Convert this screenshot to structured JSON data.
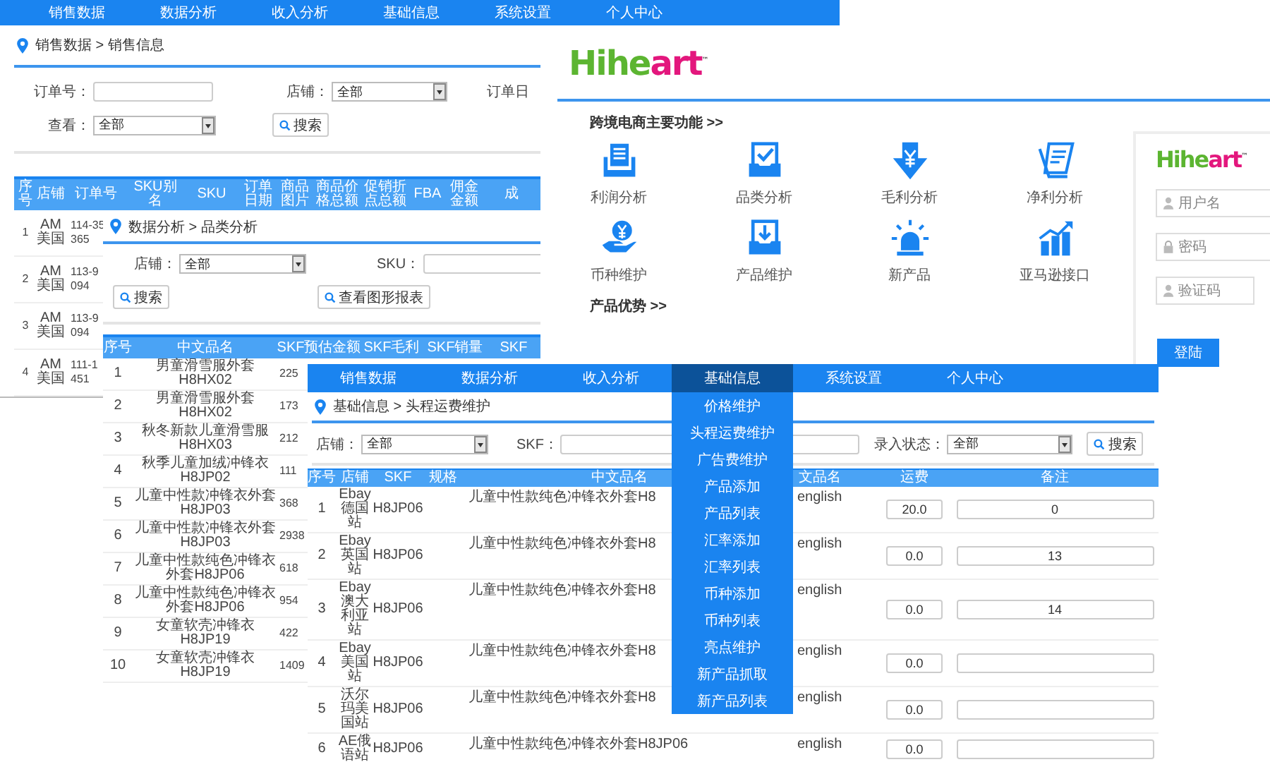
{
  "sales_window": {
    "nav": [
      {
        "label": "销售数据",
        "selected": false
      },
      {
        "label": "数据分析",
        "selected": false
      },
      {
        "label": "收入分析",
        "selected": false
      },
      {
        "label": "基础信息",
        "selected": false
      },
      {
        "label": "系统设置",
        "selected": false
      },
      {
        "label": "个人中心",
        "selected": false
      }
    ],
    "breadcrumb": "销售数据 > 销售信息",
    "filters": [
      [
        {
          "kind": "input",
          "label": "订单号："
        },
        {
          "kind": "select",
          "label": "店铺：",
          "value": "全部"
        },
        {
          "kind": "label",
          "label": "订单日"
        }
      ],
      [
        {
          "kind": "select",
          "label": "查看：",
          "value": "全部"
        },
        {
          "kind": "button",
          "label": "搜索"
        }
      ]
    ],
    "table": {
      "columns": [
        "序号",
        "店铺",
        "订单号",
        "SKU别名",
        "SKU",
        "订单日期",
        "商品图片",
        "商品价格总额",
        "促销折点总额",
        "FBA",
        "佣金金额",
        "成"
      ],
      "rows": [
        {
          "no": "1",
          "store": "AM美国",
          "order": "114-35 365"
        },
        {
          "no": "2",
          "store": "AM美国",
          "order": "113-9 094"
        },
        {
          "no": "3",
          "store": "AM美国",
          "order": "113-9 094"
        },
        {
          "no": "4",
          "store": "AM美国",
          "order": "111-1 451"
        }
      ]
    }
  },
  "home_window": {
    "logo": {
      "parts": [
        {
          "text": "Hihe",
          "color": "#5cb531"
        },
        {
          "text": "art",
          "color": "#e3177d"
        }
      ],
      "mark": "™"
    },
    "features_title": "跨境电商主要功能 >>",
    "features": [
      "利润分析",
      "品类分析",
      "毛利分析",
      "净利分析",
      "币种维护",
      "产品维护",
      "新产品",
      "亚马逊接口"
    ],
    "advantages_title": "产品优势 >>",
    "login": {
      "logo": {
        "parts": [
          {
            "text": "Hihe",
            "color": "#5cb531"
          },
          {
            "text": "art",
            "color": "#e3177d"
          }
        ],
        "mark": "™"
      },
      "fields": [
        {
          "kind": "user",
          "placeholder": "用户名"
        },
        {
          "kind": "password",
          "placeholder": "密码"
        },
        {
          "kind": "captcha",
          "placeholder": "验证码"
        }
      ],
      "button": "登陆"
    }
  },
  "category_window": {
    "breadcrumb": "数据分析 > 品类分析",
    "filters": [
      {
        "kind": "select",
        "label": "店铺：",
        "value": "全部"
      },
      {
        "kind": "input",
        "label": "SKU："
      }
    ],
    "buttons": [
      "搜索",
      "查看图形报表"
    ],
    "table": {
      "columns": [
        "序号",
        "中文品名",
        "SKF预估金额",
        "SKF毛利",
        "SKF销量",
        "SKF"
      ],
      "rows": [
        {
          "no": "1",
          "name": "男童滑雪服外套H8HX02",
          "amount": "225"
        },
        {
          "no": "2",
          "name": "男童滑雪服外套H8HX02",
          "amount": "173"
        },
        {
          "no": "3",
          "name": "秋冬新款儿童滑雪服H8HX03",
          "amount": "212"
        },
        {
          "no": "4",
          "name": "秋季儿童加绒冲锋衣H8JP02",
          "amount": "111"
        },
        {
          "no": "5",
          "name": "儿童中性款冲锋衣外套H8JP03",
          "amount": "368"
        },
        {
          "no": "6",
          "name": "儿童中性款冲锋衣外套H8JP03",
          "amount": "2938"
        },
        {
          "no": "7",
          "name": "儿童中性款纯色冲锋衣外套H8JP06",
          "amount": "618"
        },
        {
          "no": "8",
          "name": "儿童中性款纯色冲锋衣外套H8JP06",
          "amount": "954"
        },
        {
          "no": "9",
          "name": "女童软壳冲锋衣H8JP19",
          "amount": "422"
        },
        {
          "no": "10",
          "name": "女童软壳冲锋衣H8JP19",
          "amount": "1409"
        }
      ]
    }
  },
  "freight_window": {
    "nav": [
      {
        "label": "销售数据",
        "selected": false
      },
      {
        "label": "数据分析",
        "selected": false
      },
      {
        "label": "收入分析",
        "selected": false
      },
      {
        "label": "基础信息",
        "selected": true
      },
      {
        "label": "系统设置",
        "selected": false
      },
      {
        "label": "个人中心",
        "selected": false
      }
    ],
    "menu": [
      "价格维护",
      "头程运费维护",
      "广告费维护",
      "产品添加",
      "产品列表",
      "汇率添加",
      "汇率列表",
      "币种添加",
      "币种列表",
      "亮点维护",
      "新产品抓取",
      "新产品列表"
    ],
    "breadcrumb": "基础信息 > 头程运费维护",
    "filters": [
      {
        "kind": "select",
        "label": "店铺：",
        "value": "全部"
      },
      {
        "kind": "input",
        "label": "SKF："
      },
      {
        "kind": "select",
        "label": "录入状态：",
        "value": "全部"
      },
      {
        "kind": "button",
        "label": "搜索"
      }
    ],
    "table": {
      "columns": [
        "序号",
        "店铺",
        "SKF",
        "规格",
        "中文品名",
        "文品名",
        "运费",
        "备注"
      ],
      "rows": [
        {
          "no": "1",
          "store": "Ebay德国站",
          "skf": "H8JP06",
          "name": "儿童中性款纯色冲锋衣外套H8",
          "en": "english",
          "freight": "20.0",
          "note": "0"
        },
        {
          "no": "2",
          "store": "Ebay英国站",
          "skf": "H8JP06",
          "name": "儿童中性款纯色冲锋衣外套H8",
          "en": "english",
          "freight": "0.0",
          "note": "13"
        },
        {
          "no": "3",
          "store": "Ebay澳大利亚站",
          "skf": "H8JP06",
          "name": "儿童中性款纯色冲锋衣外套H8",
          "en": "english",
          "freight": "0.0",
          "note": "14"
        },
        {
          "no": "4",
          "store": "Ebay美国站",
          "skf": "H8JP06",
          "name": "儿童中性款纯色冲锋衣外套H8",
          "en": "english",
          "freight": "0.0"
        },
        {
          "no": "5",
          "store": "沃尔玛美国站",
          "skf": "H8JP06",
          "name": "儿童中性款纯色冲锋衣外套H8",
          "en": "english",
          "freight": "0.0"
        },
        {
          "no": "6",
          "store": "AE俄语站",
          "skf": "H8JP06",
          "name": "儿童中性款纯色冲锋衣外套H8JP06",
          "en": "english",
          "freight": "0.0"
        }
      ]
    }
  }
}
